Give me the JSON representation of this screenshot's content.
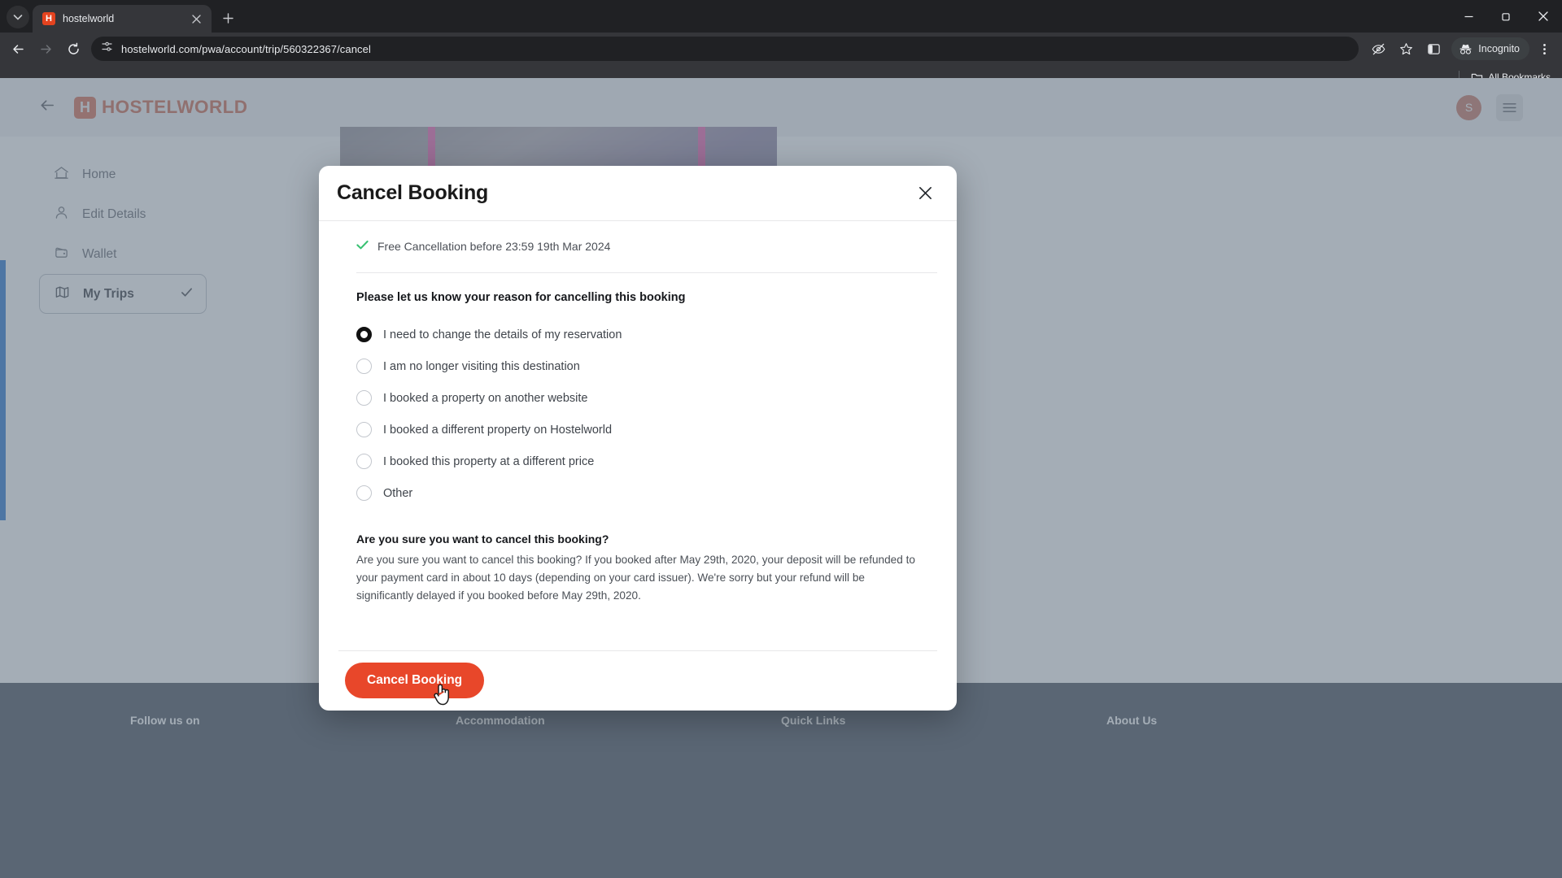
{
  "browser": {
    "tab": {
      "title": "hostelworld",
      "favicon_letter": "H",
      "favicon_name": "hostelworld-favicon"
    },
    "new_tab_label": "+",
    "url": "hostelworld.com/pwa/account/trip/560322367/cancel",
    "incognito_label": "Incognito",
    "bookmarks_label": "All Bookmarks",
    "accent_tab_color": "#e4431f"
  },
  "site": {
    "brand": "HOSTELWORLD",
    "brand_mark": "H",
    "brand_color": "#cb5f45",
    "avatar_initial": "S"
  },
  "sidebar": {
    "items": [
      {
        "label": "Home",
        "icon": "home-icon",
        "active": false
      },
      {
        "label": "Edit Details",
        "icon": "user-icon",
        "active": false
      },
      {
        "label": "Wallet",
        "icon": "wallet-icon",
        "active": false
      },
      {
        "label": "My Trips",
        "icon": "map-icon",
        "active": true
      }
    ]
  },
  "footer": {
    "columns": [
      {
        "heading": "Follow us on"
      },
      {
        "heading": "Accommodation"
      },
      {
        "heading": "Quick Links"
      },
      {
        "heading": "About Us"
      }
    ]
  },
  "modal": {
    "title": "Cancel Booking",
    "close_label": "×",
    "free_cancellation": "Free Cancellation before 23:59 19th Mar 2024",
    "free_cancellation_color": "#38c172",
    "reason_prompt": "Please let us know your reason for cancelling this booking",
    "reasons": [
      {
        "label": "I need to change the details of my reservation",
        "selected": true
      },
      {
        "label": "I am no longer visiting this destination",
        "selected": false
      },
      {
        "label": "I booked a property on another website",
        "selected": false
      },
      {
        "label": "I booked a different property on Hostelworld",
        "selected": false
      },
      {
        "label": "I booked this property at a different price",
        "selected": false
      },
      {
        "label": "Other",
        "selected": false
      }
    ],
    "confirm_heading": "Are you sure you want to cancel this booking?",
    "confirm_text": "Are you sure you want to cancel this booking? If you booked after May 29th, 2020, your deposit will be refunded to your payment card in about 10 days (depending on your card issuer). We're sorry but your refund will be significantly delayed if you booked before May 29th, 2020.",
    "submit_label": "Cancel Booking",
    "submit_color": "#e8472a"
  }
}
